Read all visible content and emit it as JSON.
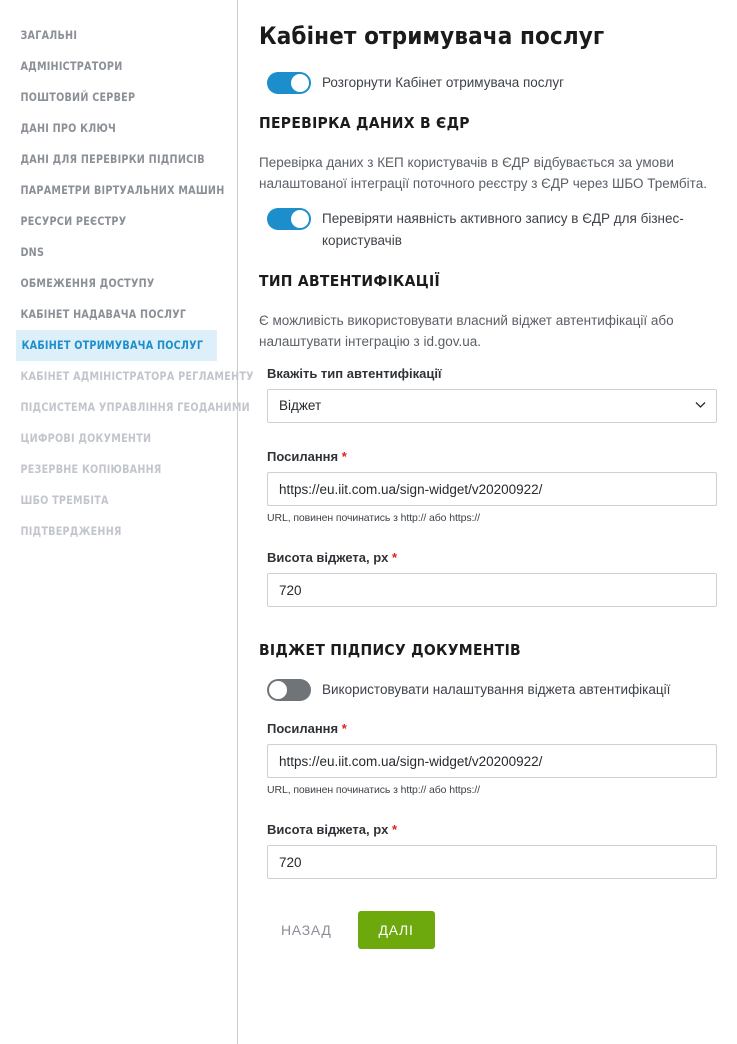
{
  "sidebar": {
    "items": [
      {
        "label": "ЗАГАЛЬНІ",
        "state": "done"
      },
      {
        "label": "АДМІНІСТРАТОРИ",
        "state": "done"
      },
      {
        "label": "ПОШТОВИЙ СЕРВЕР",
        "state": "done"
      },
      {
        "label": "ДАНІ ПРО КЛЮЧ",
        "state": "done"
      },
      {
        "label": "ДАНІ ДЛЯ ПЕРЕВІРКИ ПІДПИСІВ",
        "state": "done"
      },
      {
        "label": "ПАРАМЕТРИ ВІРТУАЛЬНИХ МАШИН",
        "state": "done"
      },
      {
        "label": "РЕСУРСИ РЕЄСТРУ",
        "state": "done"
      },
      {
        "label": "DNS",
        "state": "done"
      },
      {
        "label": "ОБМЕЖЕННЯ ДОСТУПУ",
        "state": "done"
      },
      {
        "label": "КАБІНЕТ НАДАВАЧА ПОСЛУГ",
        "state": "done"
      },
      {
        "label": "КАБІНЕТ ОТРИМУВАЧА ПОСЛУГ",
        "state": "active"
      },
      {
        "label": "КАБІНЕТ АДМІНІСТРАТОРА РЕГЛАМЕНТУ",
        "state": "future"
      },
      {
        "label": "ПІДСИСТЕМА УПРАВЛІННЯ ГЕОДАНИМИ",
        "state": "future"
      },
      {
        "label": "ЦИФРОВІ ДОКУМЕНТИ",
        "state": "future"
      },
      {
        "label": "РЕЗЕРВНЕ КОПІЮВАННЯ",
        "state": "future"
      },
      {
        "label": "ШБО ТРЕМБІТА",
        "state": "future"
      },
      {
        "label": "ПІДТВЕРДЖЕННЯ",
        "state": "future"
      }
    ]
  },
  "main": {
    "title": "Кабінет отримувача послуг",
    "deploy_toggle": {
      "label": "Розгорнути Кабінет отримувача послуг",
      "state": "on"
    },
    "edr_section": {
      "title": "ПЕРЕВІРКА ДАНИХ В ЄДР",
      "paragraph": "Перевірка даних з КЕП користувачів в ЄДР відбувається за умови налаштованої інтеграції поточного реєстру з ЄДР через ШБО Трембіта.",
      "toggle": {
        "label": "Перевіряти наявність активного запису в ЄДР для бізнес-користувачів",
        "state": "on"
      }
    },
    "auth_section": {
      "title": "ТИП АВТЕНТИФІКАЦІЇ",
      "paragraph": "Є можливість використовувати власний віджет автентифікації або налаштувати інтеграцію з id.gov.ua.",
      "select_label": "Вкажіть тип автентифікації",
      "select_value": "Віджет",
      "select_options": [
        "Віджет"
      ],
      "link_label": "Посилання",
      "link_value": "https://eu.iit.com.ua/sign-widget/v20200922/",
      "link_helper": "URL, повинен починатись з http:// або https://",
      "height_label": "Висота віджета, px",
      "height_value": "720"
    },
    "sign_section": {
      "title": "ВІДЖЕТ ПІДПИСУ ДОКУМЕНТІВ",
      "toggle": {
        "label": "Використовувати налаштування віджета автентифікації",
        "state": "off"
      },
      "link_label": "Посилання",
      "link_value": "https://eu.iit.com.ua/sign-widget/v20200922/",
      "link_helper": "URL, повинен починатись з http:// або https://",
      "height_label": "Висота віджета, px",
      "height_value": "720"
    },
    "required_marker": "*",
    "buttons": {
      "back": "НАЗАД",
      "next": "ДАЛІ"
    }
  },
  "colors": {
    "accent_blue": "#1b8ecb",
    "active_bg": "#ddeff9",
    "primary_green": "#6da80d",
    "required_red": "#e02020",
    "toggle_off_grey": "#6f7479"
  }
}
